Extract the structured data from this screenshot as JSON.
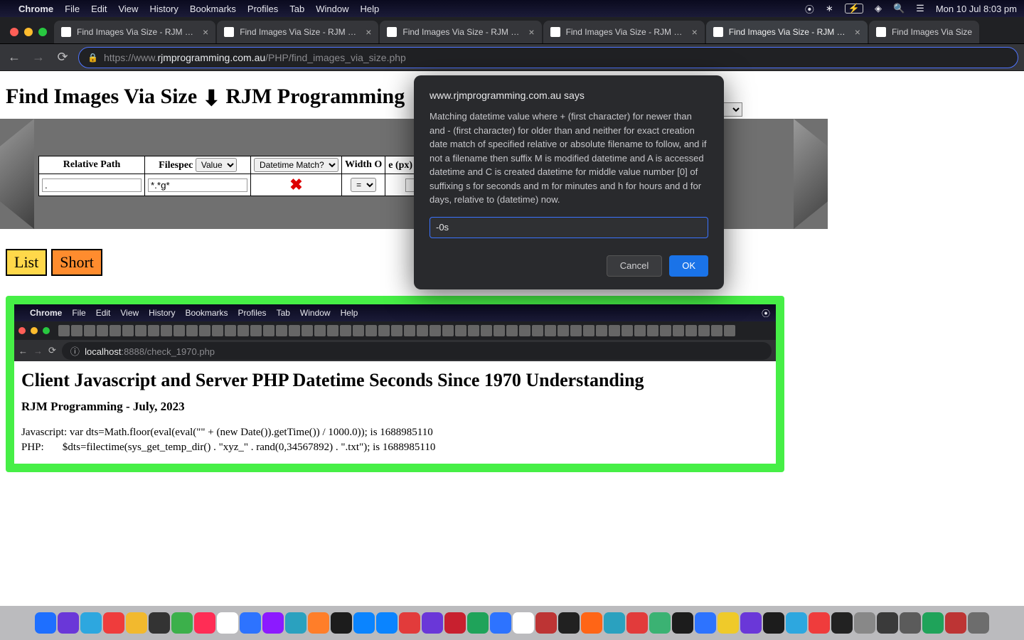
{
  "menubar": {
    "app": "Chrome",
    "items": [
      "File",
      "Edit",
      "View",
      "History",
      "Bookmarks",
      "Profiles",
      "Tab",
      "Window",
      "Help"
    ],
    "clock": "Mon 10 Jul  8:03 pm"
  },
  "tabs": [
    {
      "title": "Find Images Via Size - RJM Prc",
      "active": false
    },
    {
      "title": "Find Images Via Size - RJM Prc",
      "active": false
    },
    {
      "title": "Find Images Via Size - RJM Prc",
      "active": false
    },
    {
      "title": "Find Images Via Size - RJM Prc",
      "active": false
    },
    {
      "title": "Find Images Via Size - RJM Prc",
      "active": true
    },
    {
      "title": "Find Images Via Size",
      "active": false
    }
  ],
  "url": {
    "scheme": "https://",
    "sub": "www.",
    "host": "rjmprogramming.com.au",
    "path": "/PHP/find_images_via_size.php"
  },
  "heading": "Find Images Via Size ",
  "heading2": " RJM Programming",
  "filters": {
    "headers": [
      "Relative Path",
      "Filespec",
      "Datetime Match?",
      "Width Op",
      "e (px)"
    ],
    "filespec_label": "Filespec",
    "value_select": "Value",
    "datetime_select": "Datetime Match?",
    "width_label": "Width O",
    "px_label": "e (px)",
    "row": {
      "path": ".",
      "spec": "*.*g*",
      "dtx": "✖",
      "eq": "="
    }
  },
  "buttons": {
    "list": "List",
    "short": "Short"
  },
  "dialog": {
    "origin": "www.rjmprogramming.com.au says",
    "msg": "Matching datetime value where + (first character) for newer than and - (first character) for older than and neither for exact creation date match of specified relative or absolute filename to follow, and if not a filename then suffix M is modified datetime and A is accessed datetime and C is created datetime for middle value number [0] of suffixing s for seconds and m for minutes and h for hours and d for days, relative to (datetime) now.",
    "value": "-0s",
    "cancel": "Cancel",
    "ok": "OK"
  },
  "inset": {
    "menubar_app": "Chrome",
    "menubar_items": [
      "File",
      "Edit",
      "View",
      "History",
      "Bookmarks",
      "Profiles",
      "Tab",
      "Window",
      "Help"
    ],
    "url_info": "ⓘ",
    "url_host": "localhost",
    "url_port": ":8888/check_1970.php",
    "h2": "Client Javascript and Server PHP Datetime Seconds Since 1970 Understanding",
    "h3": "RJM Programming - July, 2023",
    "line1": "Javascript: var dts=Math.floor(eval(eval(\"\" + (new Date()).getTime()) / 1000.0)); is 1688985110",
    "line2": "PHP:       $dts=filectime(sys_get_temp_dir() . \"xyz_\" . rand(0,34567892) . \".txt\"); is 1688985110"
  }
}
